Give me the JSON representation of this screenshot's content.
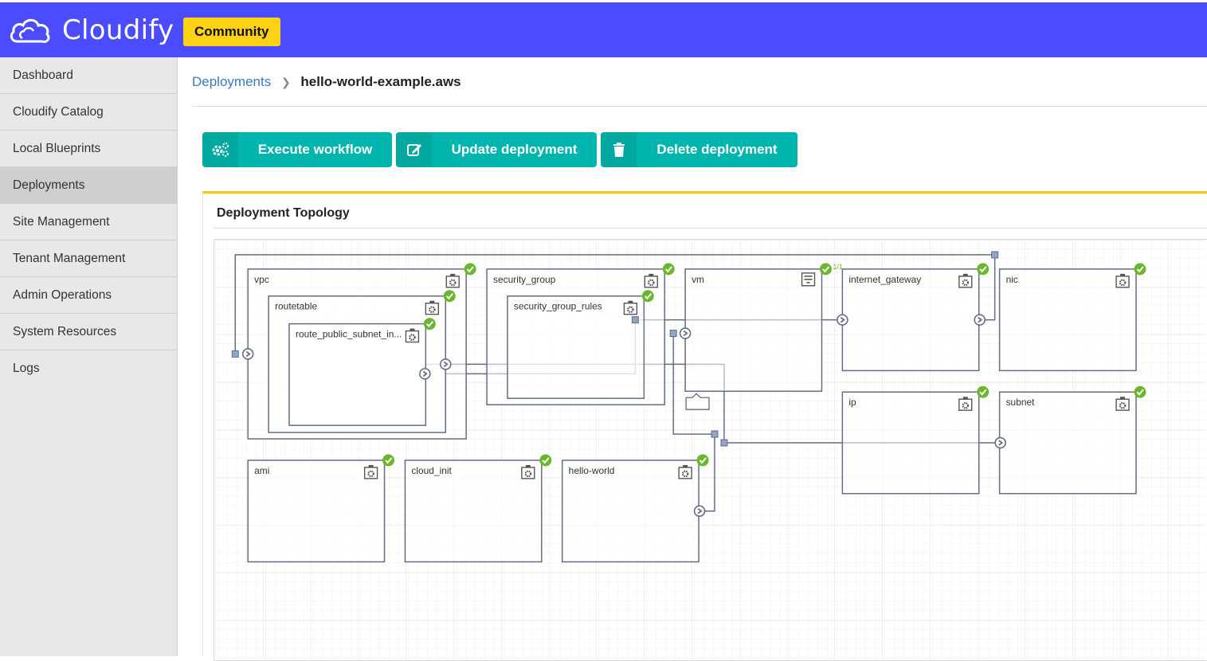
{
  "app": {
    "name": "Cloudify",
    "edition": "Community"
  },
  "sidebar": {
    "items": [
      {
        "label": "Dashboard"
      },
      {
        "label": "Cloudify Catalog"
      },
      {
        "label": "Local Blueprints"
      },
      {
        "label": "Deployments",
        "active": true
      },
      {
        "label": "Site Management"
      },
      {
        "label": "Tenant Management"
      },
      {
        "label": "Admin Operations"
      },
      {
        "label": "System Resources"
      },
      {
        "label": "Logs"
      }
    ]
  },
  "breadcrumb": {
    "parent": "Deployments",
    "current": "hello-world-example.aws"
  },
  "actions": {
    "execute": {
      "label": "Execute workflow",
      "icon": "cogs-icon"
    },
    "update": {
      "label": "Update deployment",
      "icon": "edit-icon"
    },
    "delete": {
      "label": "Delete deployment",
      "icon": "trash-icon"
    }
  },
  "widget": {
    "title": "Deployment Topology"
  },
  "topology": {
    "nodes": [
      {
        "name": "vpc",
        "status": "ok"
      },
      {
        "name": "routetable",
        "status": "ok"
      },
      {
        "name": "route_public_subnet_in...",
        "status": "ok"
      },
      {
        "name": "security_group",
        "status": "ok"
      },
      {
        "name": "security_group_rules",
        "status": "ok"
      },
      {
        "name": "vm",
        "status": "ok",
        "instances": "1/1",
        "icon": "server-icon"
      },
      {
        "name": "internet_gateway",
        "status": "ok"
      },
      {
        "name": "nic",
        "status": "ok"
      },
      {
        "name": "ip",
        "status": "ok"
      },
      {
        "name": "subnet",
        "status": "ok"
      },
      {
        "name": "ami",
        "status": "ok"
      },
      {
        "name": "cloud_init",
        "status": "ok"
      },
      {
        "name": "hello-world",
        "status": "ok"
      }
    ]
  },
  "colors": {
    "header": "#4b4bff",
    "badge": "#fcd116",
    "button": "#00b5ad",
    "ok": "#6ab72e",
    "widget_border": "#f5c518"
  }
}
